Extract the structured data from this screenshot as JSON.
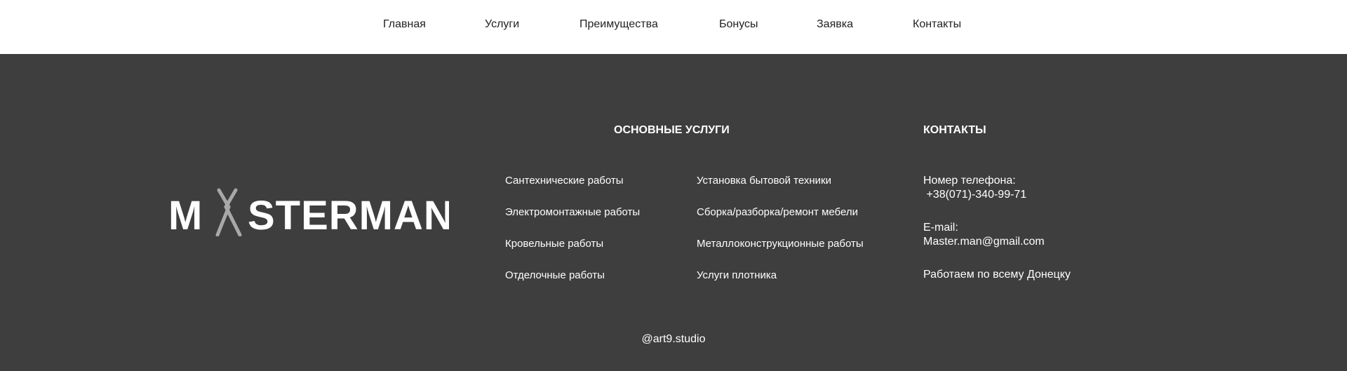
{
  "nav": {
    "items": [
      {
        "label": "Главная"
      },
      {
        "label": "Услуги"
      },
      {
        "label": "Преимущества"
      },
      {
        "label": "Бонусы"
      },
      {
        "label": "Заявка"
      },
      {
        "label": "Контакты"
      }
    ]
  },
  "logo": {
    "text": "MASTERMAN",
    "icon": "pliers-icon"
  },
  "services": {
    "heading": "ОСНОВНЫЕ УСЛУГИ",
    "col1": [
      "Сантехнические работы",
      "Электромонтажные работы",
      "Кровельные работы",
      "Отделочные работы"
    ],
    "col2": [
      "Установка бытовой техники",
      "Сборка/разборка/ремонт мебели",
      "Металлоконструкционные работы",
      "Услуги плотника"
    ]
  },
  "contacts": {
    "heading": "КОНТАКТЫ",
    "phone_label": "Номер телефона:",
    "phone": " +38(071)-340-99-71",
    "email_label": "E-mail:",
    "email": "Master.man@gmail.com",
    "area": "Работаем по всему Донецку"
  },
  "footer": {
    "credit": "@art9.studio"
  },
  "colors": {
    "footer_bg": "#3e3e3e",
    "nav_bg": "#ffffff",
    "logo_icon": "#a8a8a8"
  }
}
